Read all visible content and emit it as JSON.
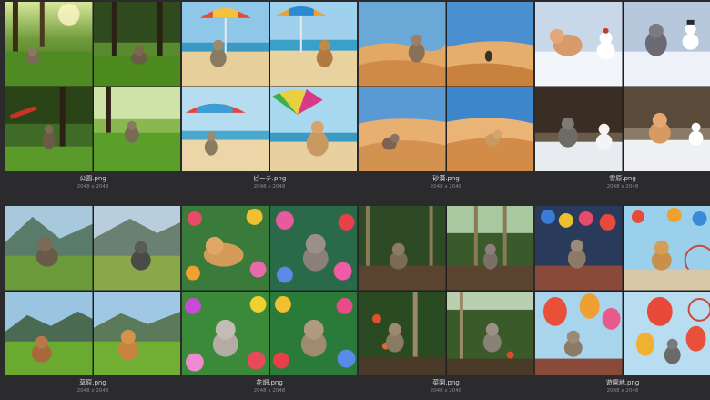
{
  "gallery": {
    "items": [
      {
        "file_name": "公園.png",
        "dimensions": "2048 x 2048",
        "scene": "park"
      },
      {
        "file_name": "ビーチ.png",
        "dimensions": "2048 x 2048",
        "scene": "beach"
      },
      {
        "file_name": "砂漠.png",
        "dimensions": "2048 x 2048",
        "scene": "desert"
      },
      {
        "file_name": "雪原.png",
        "dimensions": "2048 x 2048",
        "scene": "snowfield"
      },
      {
        "file_name": "草原.png",
        "dimensions": "2048 x 2048",
        "scene": "meadow"
      },
      {
        "file_name": "花畑.png",
        "dimensions": "2048 x 2048",
        "scene": "flower-field"
      },
      {
        "file_name": "菜園.png",
        "dimensions": "2048 x 2048",
        "scene": "vegetable-garden"
      },
      {
        "file_name": "遊園地.png",
        "dimensions": "2048 x 2048",
        "scene": "amusement-park"
      }
    ]
  }
}
